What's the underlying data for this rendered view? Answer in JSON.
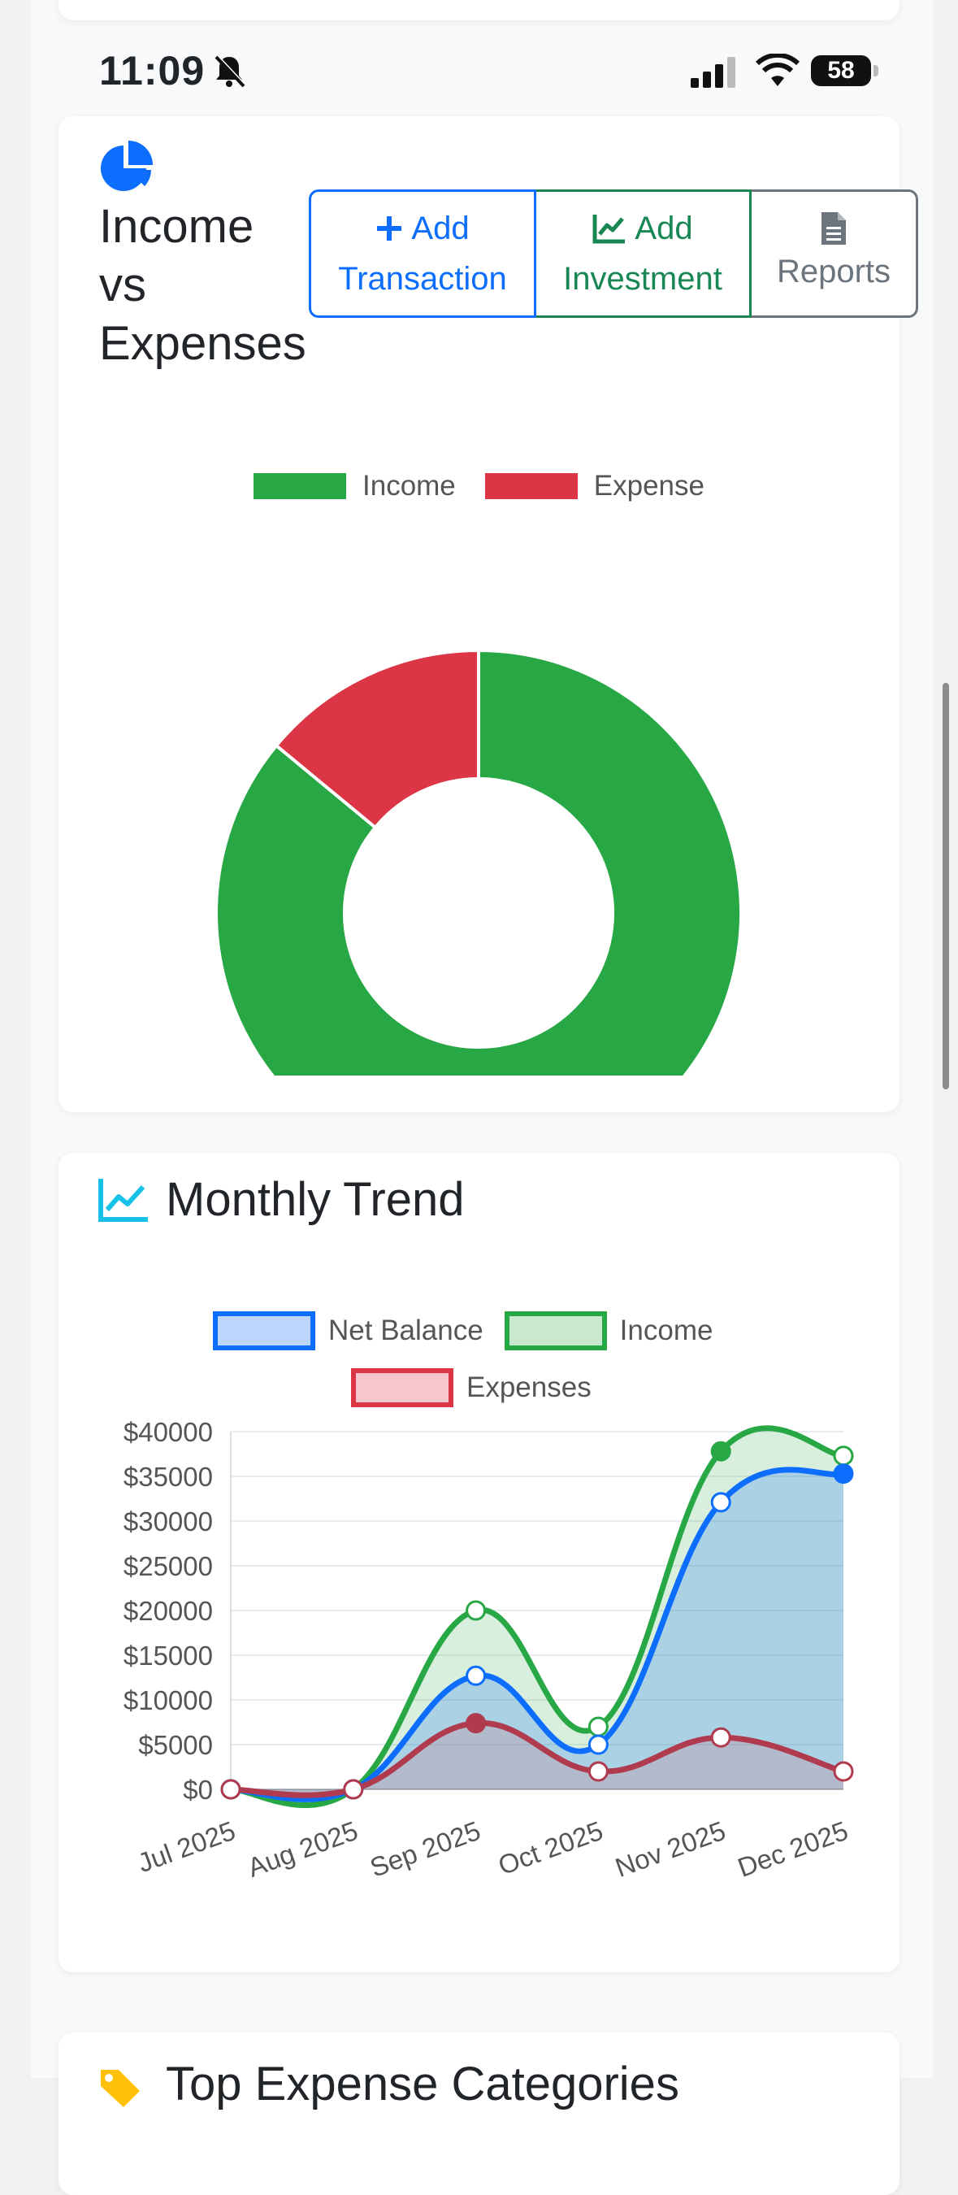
{
  "status_bar": {
    "time": "11:09",
    "battery": "58"
  },
  "income_card": {
    "title": [
      "Income",
      "vs",
      "Expenses"
    ],
    "buttons": {
      "add_transaction": [
        "Add",
        "Transaction"
      ],
      "add_investment": [
        "Add",
        "Investment"
      ],
      "reports": "Reports"
    },
    "legend": [
      "Income",
      "Expense"
    ],
    "colors": {
      "income": "#28a745",
      "expense": "#dc3545"
    }
  },
  "trend_card": {
    "title": "Monthly Trend",
    "legend": [
      "Net Balance",
      "Income",
      "Expenses"
    ],
    "colors": {
      "net": "#0d6efd",
      "income": "#28a745",
      "expense": "#b03a4e"
    }
  },
  "top_expense_card": {
    "title": "Top Expense Categories"
  },
  "chart_data": [
    {
      "type": "pie",
      "categories": [
        "Income",
        "Expense"
      ],
      "values": [
        86,
        14
      ],
      "legend": "top"
    },
    {
      "type": "line",
      "categories": [
        "Jul 2025",
        "Aug 2025",
        "Sep 2025",
        "Oct 2025",
        "Nov 2025",
        "Dec 2025"
      ],
      "series": [
        {
          "name": "Net Balance",
          "values": [
            0,
            0,
            12700,
            5000,
            32100,
            35300
          ]
        },
        {
          "name": "Income",
          "values": [
            0,
            0,
            20000,
            7000,
            37800,
            37300
          ]
        },
        {
          "name": "Expenses",
          "values": [
            0,
            0,
            7400,
            2000,
            5800,
            2000
          ]
        }
      ],
      "ylim": [
        0,
        40000
      ],
      "y_ticks": [
        "$0",
        "$5000",
        "$10000",
        "$15000",
        "$20000",
        "$25000",
        "$30000",
        "$35000",
        "$40000"
      ],
      "grid": true,
      "legend": "top"
    }
  ]
}
